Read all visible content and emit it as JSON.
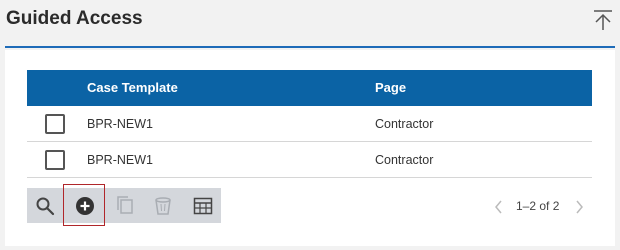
{
  "header": {
    "title": "Guided Access",
    "collapse_icon": "arrow-up-to-top-icon"
  },
  "table": {
    "columns": [
      "Case Template",
      "Page"
    ],
    "rows": [
      {
        "case_template": "BPR-NEW1",
        "page": "Contractor",
        "checked": false
      },
      {
        "case_template": "BPR-NEW1",
        "page": "Contractor",
        "checked": false
      }
    ]
  },
  "toolbar": {
    "buttons": [
      {
        "icon": "search-icon",
        "enabled": true
      },
      {
        "icon": "add-circle-icon",
        "enabled": true,
        "highlighted": true
      },
      {
        "icon": "copy-icon",
        "enabled": false
      },
      {
        "icon": "trash-icon",
        "enabled": false
      },
      {
        "icon": "table-grid-icon",
        "enabled": true
      }
    ]
  },
  "pager": {
    "label": "1–2 of 2"
  },
  "colors": {
    "accent": "#0b63a5",
    "header_rule": "#1e6bb8",
    "highlight_border": "#b0262a",
    "toolbar_bg": "#d4d7dc"
  }
}
